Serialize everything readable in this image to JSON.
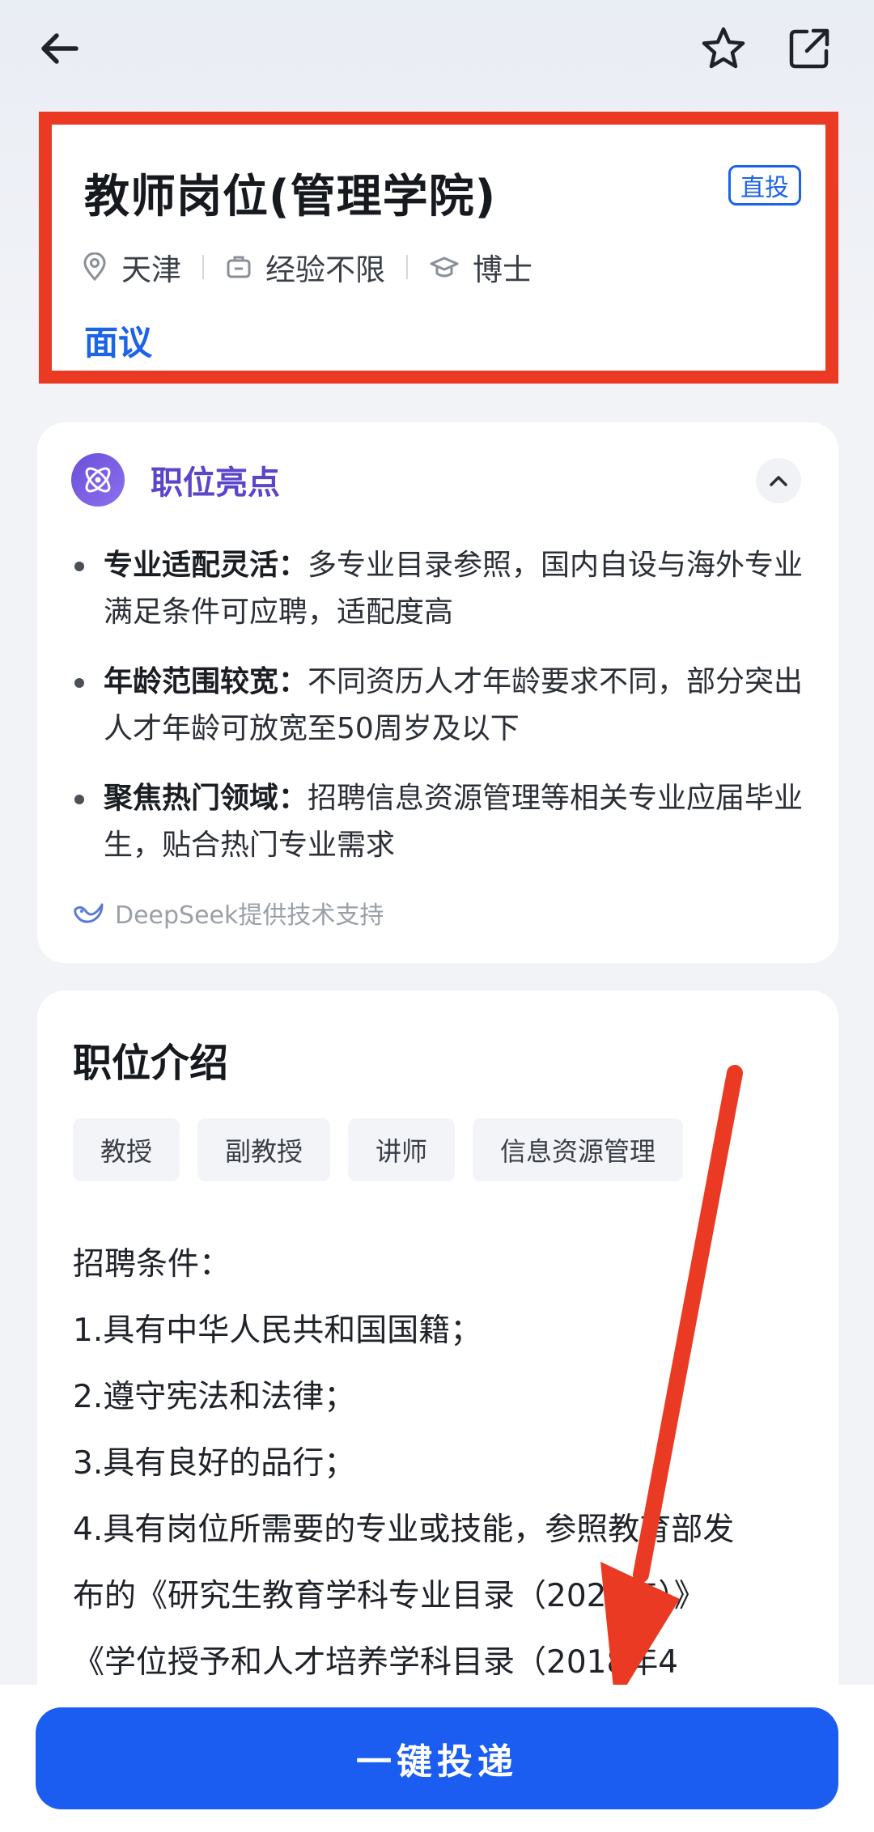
{
  "topbar": {
    "back_icon": "arrow-left-icon",
    "favorite_icon": "star-icon",
    "share_icon": "share-icon"
  },
  "job": {
    "title": "教师岗位(管理学院)",
    "badge": "直投",
    "location": "天津",
    "experience": "经验不限",
    "education": "博士",
    "salary": "面议"
  },
  "highlights": {
    "title": "职位亮点",
    "items": [
      {
        "label": "专业适配灵活：",
        "text": "多专业目录参照，国内自设与海外专业满足条件可应聘，适配度高"
      },
      {
        "label": "年龄范围较宽：",
        "text": "不同资历人才年龄要求不同，部分突出人才年龄可放宽至50周岁及以下"
      },
      {
        "label": "聚焦热门领域：",
        "text": "招聘信息资源管理等相关专业应届毕业生，贴合热门专业需求"
      }
    ],
    "powered_by": "DeepSeek提供技术支持"
  },
  "intro": {
    "title": "职位介绍",
    "tags": [
      "教授",
      "副教授",
      "讲师",
      "信息资源管理"
    ],
    "lines": [
      "招聘条件：",
      "1.具有中华人民共和国国籍；",
      "2.遵守宪法和法律；",
      "3.具有良好的品行；",
      "4.具有岗位所需要的专业或技能，参照教育部发",
      "布的《研究生教育学科专业目录（2022年）》",
      "《学位授予和人才培养学科目录（2018年4"
    ]
  },
  "bottom": {
    "apply_label": "一键投递"
  },
  "colors": {
    "brand_blue": "#1a5df0",
    "highlight_purple": "#5b45c9",
    "annotation_red": "#ea3a23"
  }
}
